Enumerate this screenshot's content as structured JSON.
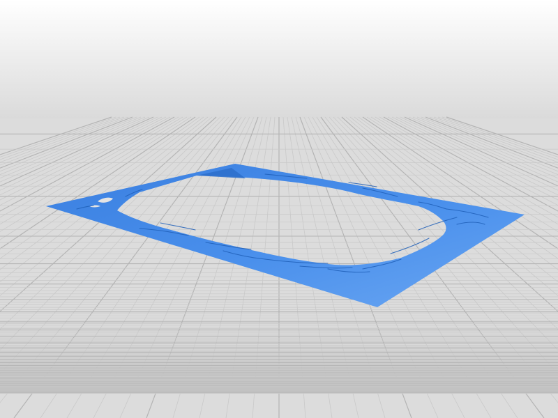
{
  "scene": {
    "description_visible_text": "",
    "colors": {
      "background_top": "#ffffff",
      "background_horizon": "#d9d9d9",
      "floor": "#dcdcdc",
      "grid_line": "#b4b4b4",
      "grid_line_minor": "#c9c9c9",
      "object_fill": "#3d86e6",
      "object_highlight": "#6aa6f2",
      "object_shadow": "#2a6fcf",
      "crack_line": "#1f5fb8"
    },
    "object": {
      "kind": "flat-frame",
      "shape": "rectangular-plate-with-irregular-cutout"
    }
  }
}
